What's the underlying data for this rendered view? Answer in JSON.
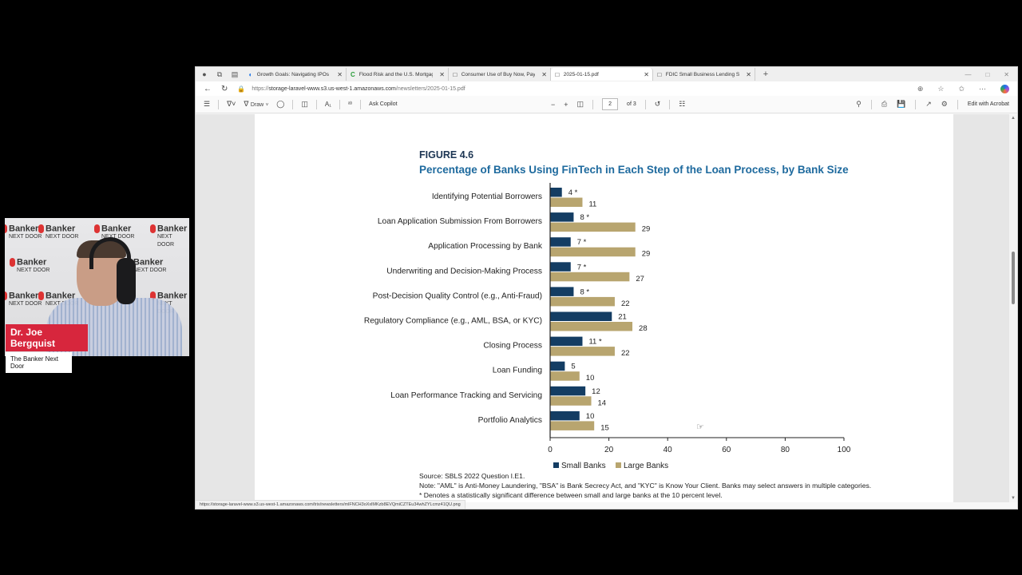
{
  "webcam": {
    "watermark": "Banker",
    "watermark_sub": "NEXT DOOR",
    "presenter_name": "Dr. Joe Bergquist",
    "show_name": "The Banker Next Door"
  },
  "browser": {
    "tabs": [
      {
        "label": "Growth Goals: Navigating IPOs a",
        "icon": "edge-icon",
        "active": false
      },
      {
        "label": "Flood Risk and the U.S. Mortgage",
        "icon": "c-icon",
        "active": false
      },
      {
        "label": "Consumer Use of Buy Now, Pay L",
        "icon": "doc-icon",
        "active": false
      },
      {
        "label": "2025-01-15.pdf",
        "icon": "doc-icon",
        "active": true
      },
      {
        "label": "FDIC Small Business Lending Sur",
        "icon": "doc-icon",
        "active": false
      }
    ],
    "new_tab": "+",
    "url_prefix": "https://",
    "url_host": "storage-laravel-www.s3.us-west-1.amazonaws.com",
    "url_path": "/newsletters/2025-01-15.pdf",
    "status_url": "https://storage-laravel-www.s3.us-west-1.amazonaws.com/trix/newsletters/mlFNCH3oXxlMKzb8EVQmiCZTEu34whZYLcmz41QU.png"
  },
  "pdf_toolbar": {
    "draw_label": "Draw",
    "ask_copilot_label": "Ask Copilot",
    "page_current": "2",
    "page_total": "of 3",
    "edit_acrobat_label": "Edit with Acrobat"
  },
  "figure": {
    "number": "FIGURE 4.6",
    "title": "Percentage of Banks Using FinTech in Each Step of the Loan Process, by Bank Size",
    "source": "Source: SBLS 2022 Question I.E1.",
    "note": "Note: \"AML\" is Anti-Money Laundering, \"BSA\" is Bank Secrecy Act, and \"KYC\" is Know Your Client. Banks may select answers in multiple categories.",
    "footnote": "* Denotes a statistically significant difference between small and large banks at the 10 percent level."
  },
  "chart_data": {
    "type": "bar",
    "orientation": "horizontal",
    "title": "Percentage of Banks Using FinTech in Each Step of the Loan Process, by Bank Size",
    "xlabel": "",
    "ylabel": "",
    "xlim": [
      0,
      100
    ],
    "xticks": [
      0,
      20,
      40,
      60,
      80,
      100
    ],
    "grid": false,
    "legend_position": "bottom-left",
    "categories": [
      "Identifying Potential Borrowers",
      "Loan Application Submission From Borrowers",
      "Application Processing by Bank",
      "Underwriting and Decision-Making Process",
      "Post-Decision Quality Control (e.g., Anti-Fraud)",
      "Regulatory Compliance (e.g., AML, BSA, or KYC)",
      "Closing Process",
      "Loan Funding",
      "Loan Performance Tracking and Servicing",
      "Portfolio Analytics"
    ],
    "series": [
      {
        "name": "Small Banks",
        "color": "#143d63",
        "values": [
          4,
          8,
          7,
          7,
          8,
          21,
          11,
          5,
          12,
          10
        ],
        "significant": [
          true,
          true,
          true,
          true,
          true,
          false,
          true,
          false,
          false,
          false
        ]
      },
      {
        "name": "Large Banks",
        "color": "#b8a56f",
        "values": [
          11,
          29,
          29,
          27,
          22,
          28,
          22,
          10,
          14,
          15
        ]
      }
    ]
  }
}
